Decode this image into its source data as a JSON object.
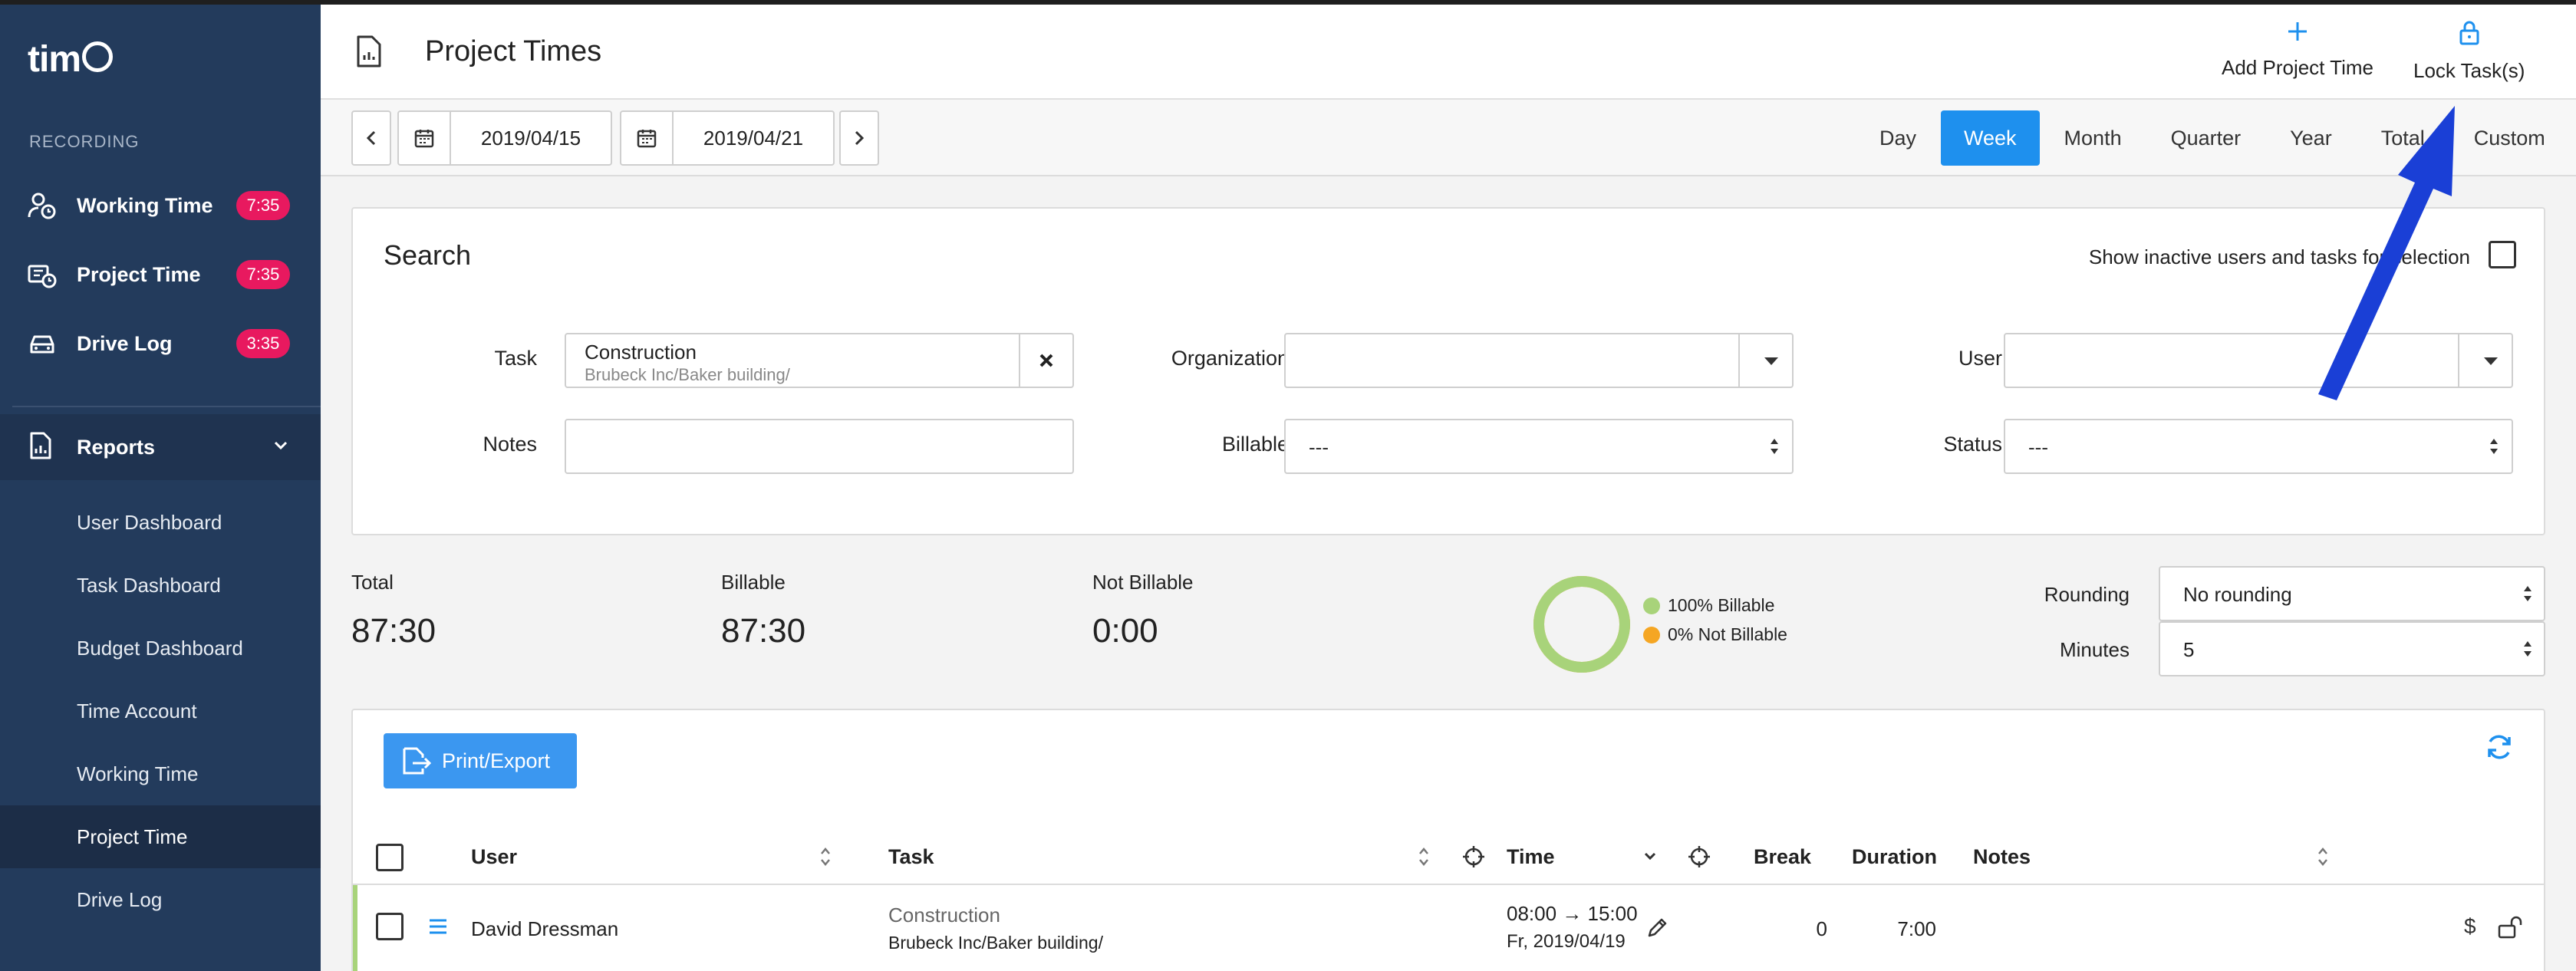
{
  "app": {
    "logo_text": "tim"
  },
  "sidebar": {
    "section_label": "RECORDING",
    "recording": [
      {
        "label": "Working Time",
        "badge": "7:35",
        "icon": "user-clock-icon"
      },
      {
        "label": "Project Time",
        "badge": "7:35",
        "icon": "project-clock-icon"
      },
      {
        "label": "Drive Log",
        "badge": "3:35",
        "icon": "car-icon"
      }
    ],
    "reports": {
      "label": "Reports",
      "icon": "report-icon"
    },
    "report_items": [
      {
        "label": "User Dashboard"
      },
      {
        "label": "Task Dashboard"
      },
      {
        "label": "Budget Dashboard"
      },
      {
        "label": "Time Account"
      },
      {
        "label": "Working Time"
      },
      {
        "label": "Project Time"
      },
      {
        "label": "Drive Log"
      }
    ]
  },
  "header": {
    "title": "Project Times",
    "add_label": "Add Project Time",
    "lock_label": "Lock Task(s)"
  },
  "toolbar": {
    "date_from": "2019/04/15",
    "date_to": "2019/04/21",
    "periods": [
      "Day",
      "Week",
      "Month",
      "Quarter",
      "Year",
      "Total",
      "Custom"
    ],
    "active_period": "Week"
  },
  "search": {
    "title": "Search",
    "inactive_label": "Show inactive users and tasks for selection",
    "task_label": "Task",
    "task_value": "Construction",
    "task_path": "Brubeck Inc/Baker building/",
    "organization_label": "Organization",
    "user_label": "User",
    "notes_label": "Notes",
    "billable_label": "Billable",
    "billable_value": "---",
    "status_label": "Status",
    "status_value": "---"
  },
  "totals": {
    "total_label": "Total",
    "total_value": "87:30",
    "billable_label": "Billable",
    "billable_value": "87:30",
    "not_billable_label": "Not Billable",
    "not_billable_value": "0:00",
    "legend_billable": "100% Billable",
    "legend_not_billable": "0% Not Billable",
    "billable_fraction": 1.0,
    "rounding_label": "Rounding",
    "rounding_value": "No rounding",
    "minutes_label": "Minutes",
    "minutes_value": "5"
  },
  "colors": {
    "sidebar_bg": "#233b5c",
    "accent": "#1e90ee",
    "badge": "#e8195f",
    "billable": "#a8d37a",
    "not_billable": "#f5a623",
    "annotation_arrow": "#1a3fd6"
  },
  "table": {
    "export_label": "Print/Export",
    "headers": {
      "user": "User",
      "task": "Task",
      "time": "Time",
      "break": "Break",
      "duration": "Duration",
      "notes": "Notes"
    },
    "rows": [
      {
        "user": "David Dressman",
        "task": "Construction",
        "task_path": "Brubeck Inc/Baker building/",
        "time_range": "08:00 → 15:00",
        "date": "Fr, 2019/04/19",
        "break": "0",
        "duration": "7:00"
      }
    ]
  }
}
